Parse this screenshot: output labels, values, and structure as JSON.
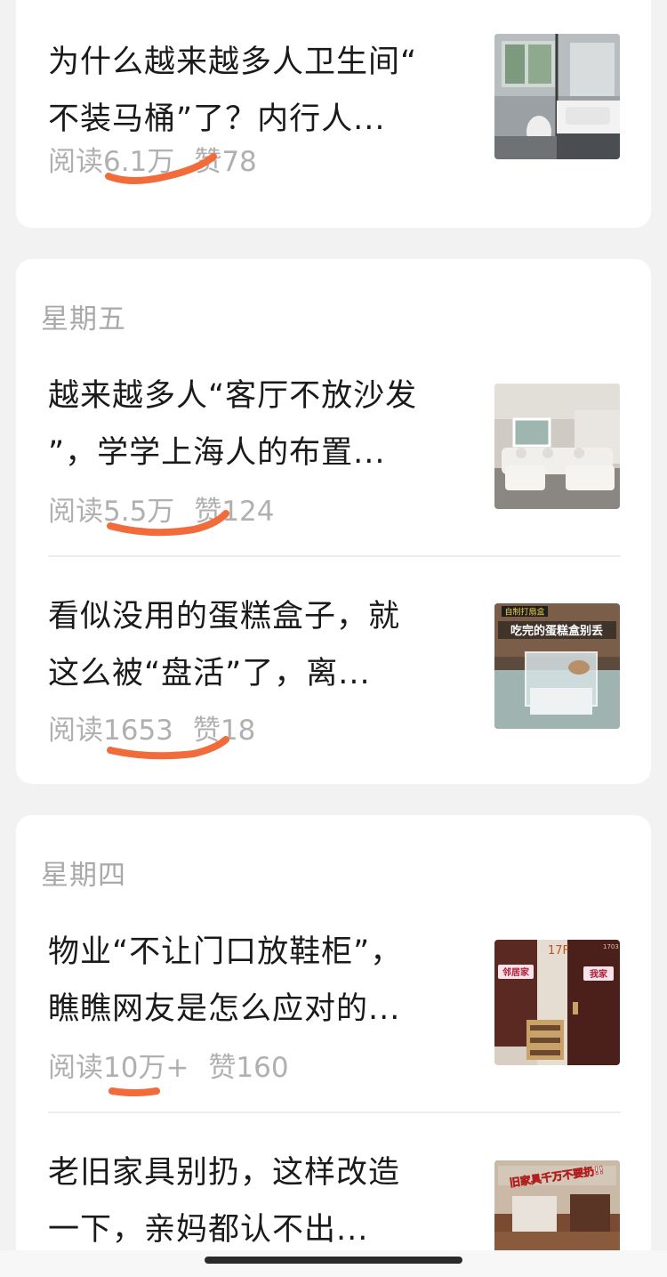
{
  "sections": [
    {
      "day": "",
      "articles": [
        {
          "title_lines": [
            "为什么越来越多人卫生间“",
            "不装马桶”了？内行人..."
          ],
          "reads_label": "阅读",
          "reads_value": "6.1万",
          "likes_label": "赞",
          "likes_value": "78",
          "thumb_icon": "bathroom-photo"
        }
      ]
    },
    {
      "day": "星期五",
      "articles": [
        {
          "title_lines": [
            "越来越多人“客厅不放沙发",
            "”，学学上海人的布置..."
          ],
          "reads_label": "阅读",
          "reads_value": "5.5万",
          "likes_label": "赞",
          "likes_value": "124",
          "thumb_icon": "living-room-sofa-photo"
        },
        {
          "title_lines": [
            "看似没用的蛋糕盒子，就",
            "这么被“盘活”了，离..."
          ],
          "reads_label": "阅读",
          "reads_value": "1653",
          "likes_label": "赞",
          "likes_value": "18",
          "thumb_icon": "cake-box-photo",
          "thumb_caption_top": "自制打扇盒",
          "thumb_caption_main": "吃完的蛋糕盒别丢"
        }
      ]
    },
    {
      "day": "星期四",
      "articles": [
        {
          "title_lines": [
            "物业“不让门口放鞋柜”，",
            "瞧瞧网友是怎么应对的..."
          ],
          "reads_label": "阅读",
          "reads_value": "10万+",
          "likes_label": "赞",
          "likes_value": "160",
          "thumb_icon": "apartment-doors-photo",
          "thumb_sign_left": "邻居家",
          "thumb_sign_right": "我家",
          "thumb_floor": "17F",
          "thumb_room": "1703"
        },
        {
          "title_lines": [
            "老旧家具别扔，这样改造",
            "一下，亲妈都认不出..."
          ],
          "thumb_icon": "old-furniture-room-photo",
          "thumb_caption_main": "旧家具千万不要扔!!"
        }
      ]
    }
  ],
  "colors": {
    "annotation": "#f26b3a",
    "background": "#f2f2f2",
    "card": "#ffffff",
    "meta_text": "#b0b0b0",
    "title_text": "#1a1a1a"
  }
}
